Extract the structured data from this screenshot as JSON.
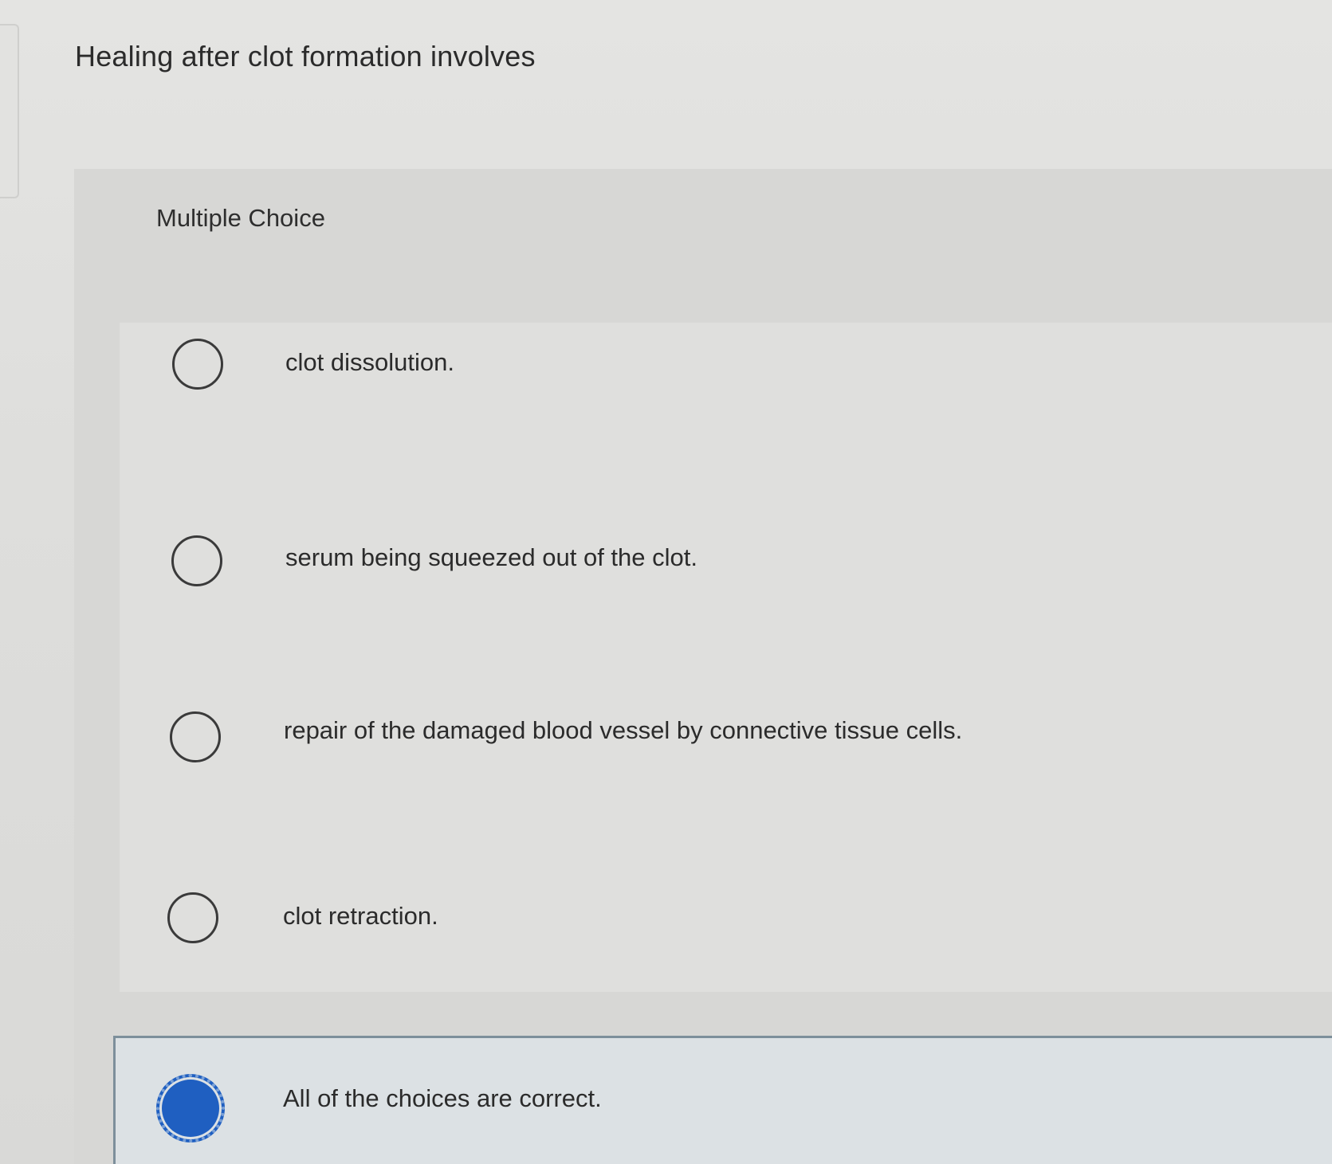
{
  "question": {
    "prompt": "Healing after clot formation involves",
    "type_label": "Multiple Choice"
  },
  "choices": [
    {
      "label": "clot dissolution.",
      "selected": false
    },
    {
      "label": "serum being squeezed out of the clot.",
      "selected": false
    },
    {
      "label": "repair of the damaged blood vessel by connective tissue cells.",
      "selected": false
    },
    {
      "label": "clot retraction.",
      "selected": false
    },
    {
      "label": "All of the choices are correct.",
      "selected": true
    }
  ],
  "colors": {
    "background": "#dcdcda",
    "text": "#2b2b2b",
    "radio_selected": "#1f5fc1",
    "selected_row_border": "#7d8f9b"
  }
}
